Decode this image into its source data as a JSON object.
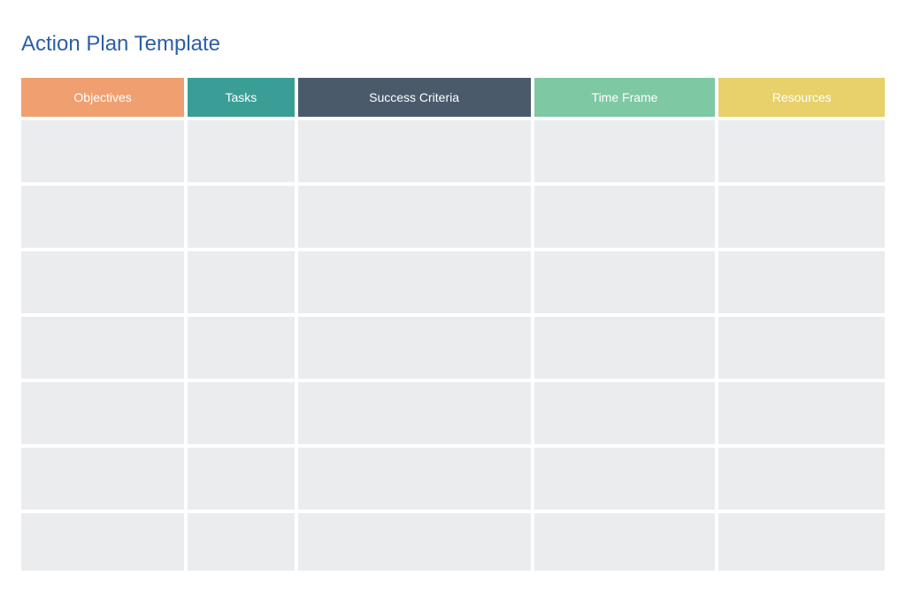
{
  "page": {
    "title": "Action Plan Template"
  },
  "table": {
    "columns": [
      {
        "id": "objectives",
        "label": "Objectives",
        "colorClass": "col-objectives"
      },
      {
        "id": "tasks",
        "label": "Tasks",
        "colorClass": "col-tasks"
      },
      {
        "id": "success-criteria",
        "label": "Success Criteria",
        "colorClass": "col-success"
      },
      {
        "id": "time-frame",
        "label": "Time Frame",
        "colorClass": "col-timeframe"
      },
      {
        "id": "resources",
        "label": "Resources",
        "colorClass": "col-resources"
      }
    ],
    "rowCount": 7
  }
}
